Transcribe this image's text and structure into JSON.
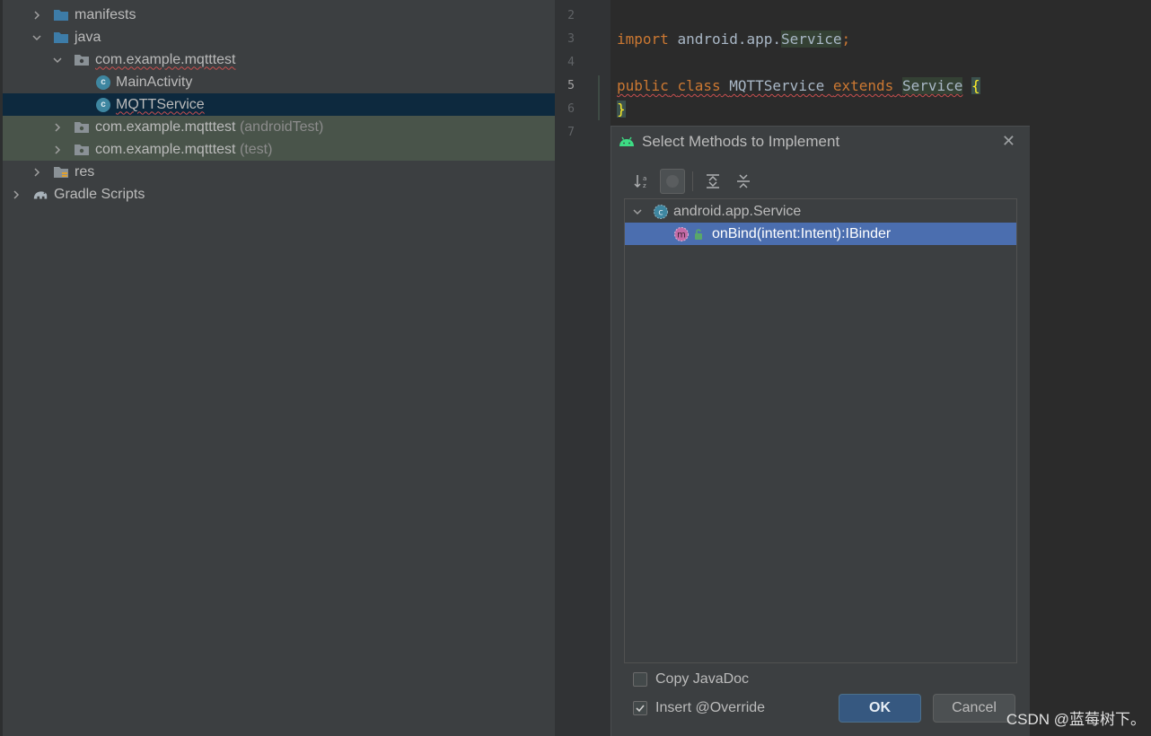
{
  "project_tree": {
    "items": [
      {
        "label": "manifests",
        "suffix": ""
      },
      {
        "label": "java",
        "suffix": ""
      },
      {
        "label": "com.example.mqtttest",
        "suffix": ""
      },
      {
        "label": "MainActivity",
        "suffix": ""
      },
      {
        "label": "MQTTService",
        "suffix": ""
      },
      {
        "label": "com.example.mqtttest",
        "suffix": "(androidTest)"
      },
      {
        "label": "com.example.mqtttest",
        "suffix": "(test)"
      },
      {
        "label": "res",
        "suffix": ""
      },
      {
        "label": "Gradle Scripts",
        "suffix": ""
      }
    ]
  },
  "editor": {
    "line_numbers": [
      "2",
      "3",
      "4",
      "5",
      "6",
      "7"
    ],
    "current_line": "5",
    "line3": {
      "kw": "import",
      "pkg": "android.app.",
      "cls": "Service",
      "semi": ";"
    },
    "line5": {
      "kw1": "public",
      "kw2": "class",
      "name": "MQTTService",
      "kw3": "extends",
      "base": "Service",
      "brace": "{"
    },
    "line6": {
      "brace": "}"
    }
  },
  "dialog": {
    "title": "Select Methods to Implement",
    "close_glyph": "✕",
    "tree": {
      "class_name": "android.app.Service",
      "method": "onBind(intent:Intent):IBinder",
      "method_badge": "m",
      "class_badge": "c"
    },
    "options": {
      "copy_javadoc": {
        "label": "Copy JavaDoc",
        "checked": false
      },
      "insert_override": {
        "label": "Insert @Override",
        "checked": true
      }
    },
    "ok_label": "OK",
    "cancel_label": "Cancel"
  },
  "watermark": "CSDN @蓝莓树下。",
  "colors": {
    "selection": "#4b6eaf",
    "tree_selected": "#0d293e",
    "test_folder": "#49544a",
    "keyword": "#cc7832"
  }
}
